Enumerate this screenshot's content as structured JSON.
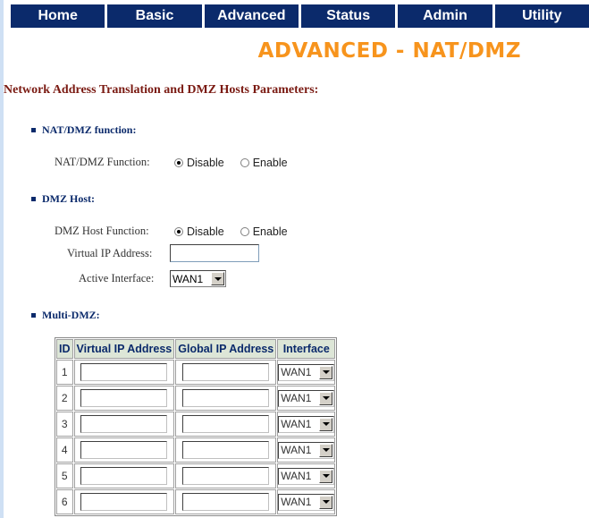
{
  "nav": {
    "items": [
      {
        "label": "Home"
      },
      {
        "label": "Basic"
      },
      {
        "label": "Advanced"
      },
      {
        "label": "Status"
      },
      {
        "label": "Admin"
      },
      {
        "label": "Utility"
      }
    ]
  },
  "page_title": "ADVANCED - NAT/DMZ",
  "section_heading": "Network Address Translation and DMZ Hosts Parameters:",
  "nat_dmz": {
    "heading": "NAT/DMZ function:",
    "function_label": "NAT/DMZ Function:",
    "options": [
      {
        "label": "Disable",
        "checked": true
      },
      {
        "label": "Enable",
        "checked": false
      }
    ]
  },
  "dmz_host": {
    "heading": "DMZ Host:",
    "function_label": "DMZ Host Function:",
    "options": [
      {
        "label": "Disable",
        "checked": true
      },
      {
        "label": "Enable",
        "checked": false
      }
    ],
    "virtual_ip_label": "Virtual IP Address:",
    "virtual_ip_value": "",
    "active_interface_label": "Active Interface:",
    "active_interface_value": "WAN1"
  },
  "multi_dmz": {
    "heading": "Multi-DMZ:",
    "columns": [
      "ID",
      "Virtual IP Address",
      "Global IP Address",
      "Interface"
    ],
    "rows": [
      {
        "id": "1",
        "virtual_ip": "",
        "global_ip": "",
        "interface": "WAN1"
      },
      {
        "id": "2",
        "virtual_ip": "",
        "global_ip": "",
        "interface": "WAN1"
      },
      {
        "id": "3",
        "virtual_ip": "",
        "global_ip": "",
        "interface": "WAN1"
      },
      {
        "id": "4",
        "virtual_ip": "",
        "global_ip": "",
        "interface": "WAN1"
      },
      {
        "id": "5",
        "virtual_ip": "",
        "global_ip": "",
        "interface": "WAN1"
      },
      {
        "id": "6",
        "virtual_ip": "",
        "global_ip": "",
        "interface": "WAN1"
      }
    ]
  },
  "colors": {
    "nav_bg": "#0b2a6b",
    "title": "#f7941d",
    "section_heading": "#7a1a12",
    "table_header_bg": "#dde6d7"
  }
}
